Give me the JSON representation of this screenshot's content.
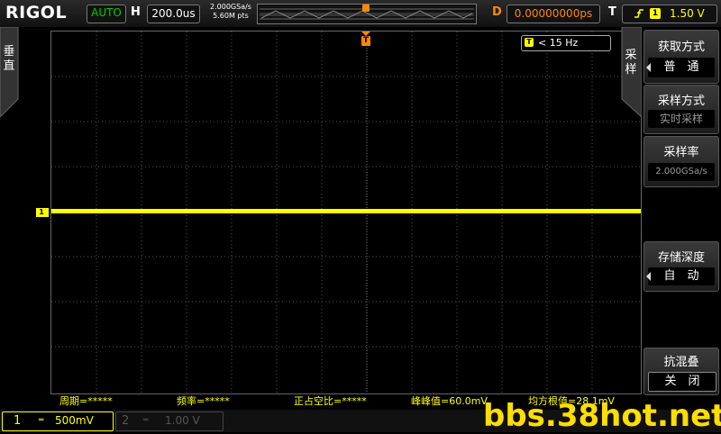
{
  "header": {
    "brand": "RIGOL",
    "run_state": "AUTO",
    "horizontal_label": "H",
    "timebase": "200.0us",
    "sample_rate": "2.000GSa/s",
    "memory_points": "5.60M pts",
    "delay_label": "D",
    "delay_value": "0.00000000ps",
    "trigger_label": "T",
    "trigger_channel": "1",
    "trigger_level": "1.50 V"
  },
  "left_tab": {
    "label": "垂直"
  },
  "screen": {
    "ch1_marker": "1",
    "trigger_marker": "T",
    "freq_icon": "T",
    "freq_readout": "< 15 Hz"
  },
  "menu": {
    "tab_label": "采样",
    "items": [
      {
        "title": "获取方式",
        "value": "普　通"
      },
      {
        "title": "采样方式",
        "value": "实时采样"
      },
      {
        "title": "采样率",
        "value": "2.000GSa/s"
      },
      {
        "title": "存储深度",
        "value": "自　动"
      },
      {
        "title": "抗混叠",
        "value": "关　闭"
      }
    ]
  },
  "measurements": [
    "周期=*****",
    "频率=*****",
    "正占空比=*****",
    "峰峰值=60.0mV",
    "均方根值=28.1mV"
  ],
  "channels": [
    {
      "number": "1",
      "coupling": "═",
      "scale": "500mV"
    },
    {
      "number": "2",
      "coupling": "═",
      "scale": "1.00 V"
    }
  ],
  "watermark": "bbs.38hot.net",
  "colors": {
    "ch1": "#ffff00",
    "trigger": "#ff8800",
    "run": "#00cc00"
  }
}
